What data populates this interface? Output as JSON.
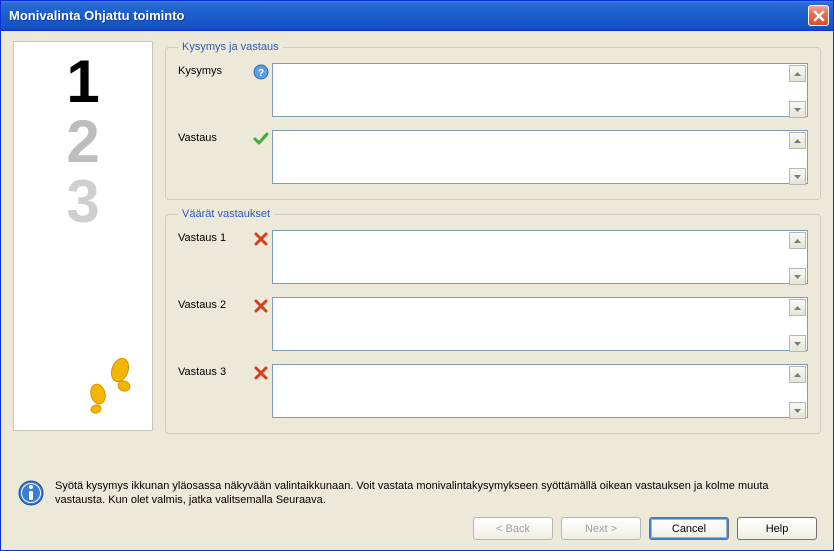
{
  "window": {
    "title": "Monivalinta Ohjattu toiminto"
  },
  "group_qa": {
    "legend": "Kysymys ja vastaus",
    "question_label": "Kysymys",
    "question_value": "",
    "answer_label": "Vastaus",
    "answer_value": ""
  },
  "group_wrong": {
    "legend": "Väärät vastaukset",
    "answer1_label": "Vastaus 1",
    "answer1_value": "",
    "answer2_label": "Vastaus 2",
    "answer2_value": "",
    "answer3_label": "Vastaus 3",
    "answer3_value": ""
  },
  "info": {
    "text": "Syötä kysymys ikkunan yläosassa näkyvään valintaikkunaan. Voit vastata monivalintakysymykseen syöttämällä oikean vastauksen ja kolme muuta vastausta. Kun olet valmis, jatka valitsemalla Seuraava."
  },
  "buttons": {
    "back": "< Back",
    "next": "Next >",
    "cancel": "Cancel",
    "help": "Help"
  },
  "icons": {
    "question": "question-icon",
    "correct": "checkmark-icon",
    "wrong": "cross-icon",
    "info": "info-icon",
    "close": "close-icon",
    "spin_up": "spin-up-icon",
    "spin_down": "spin-down-icon"
  }
}
